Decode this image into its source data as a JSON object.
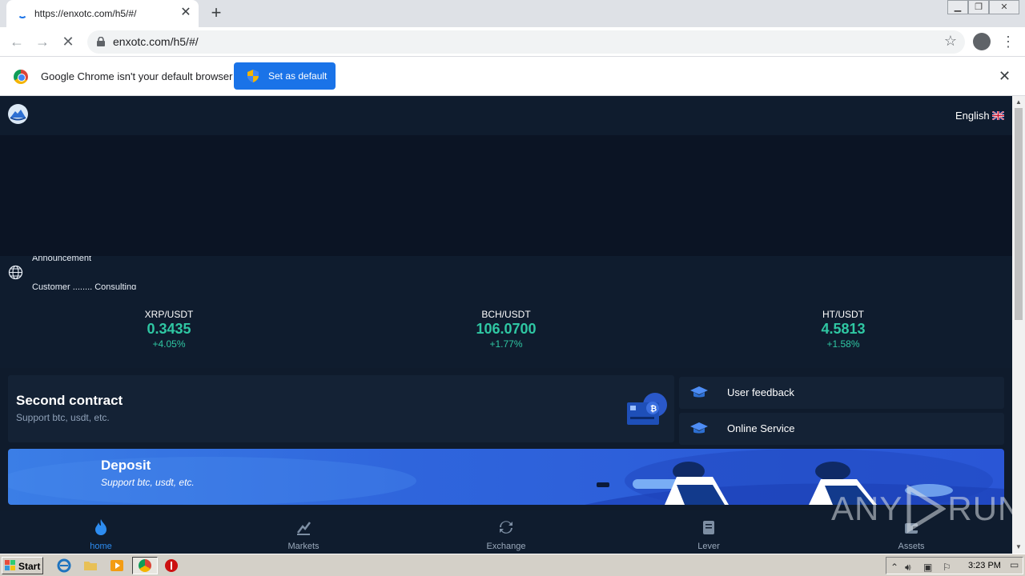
{
  "browser": {
    "tab_title": "https://enxotc.com/h5/#/",
    "tab_close": "✕",
    "new_tab": "+",
    "url": "enxotc.com/h5/#/",
    "infobar_text": "Google Chrome isn't your default browser",
    "set_default_label": "Set as default",
    "infobar_close": "✕"
  },
  "header": {
    "language": "English"
  },
  "announcement": {
    "line1": "Announcement",
    "line2": "Customer ........ Consulting"
  },
  "tickers": [
    {
      "pair": "XRP/USDT",
      "price": "0.3435",
      "change": "+4.05%"
    },
    {
      "pair": "BCH/USDT",
      "price": "106.0700",
      "change": "+1.77%"
    },
    {
      "pair": "HT/USDT",
      "price": "4.5813",
      "change": "+1.58%"
    }
  ],
  "second_contract": {
    "title": "Second contract",
    "subtitle": "Support btc, usdt, etc."
  },
  "side_items": [
    {
      "label": "User feedback"
    },
    {
      "label": "Online Service"
    }
  ],
  "deposit": {
    "title": "Deposit",
    "subtitle": "Support btc, usdt, etc."
  },
  "bottom_nav": [
    {
      "label": "home",
      "icon": "flame-icon"
    },
    {
      "label": "Markets",
      "icon": "markets-icon"
    },
    {
      "label": "Exchange",
      "icon": "exchange-icon"
    },
    {
      "label": "Lever",
      "icon": "lever-icon"
    },
    {
      "label": "Assets",
      "icon": "assets-icon"
    }
  ],
  "watermark": {
    "left": "ANY",
    "right": "RUN"
  },
  "taskbar": {
    "start_label": "Start",
    "clock": "3:23 PM"
  },
  "colors": {
    "accent_green": "#2fc7a3",
    "active_blue": "#2d8cf0",
    "page_bg": "#0f1b2c"
  }
}
